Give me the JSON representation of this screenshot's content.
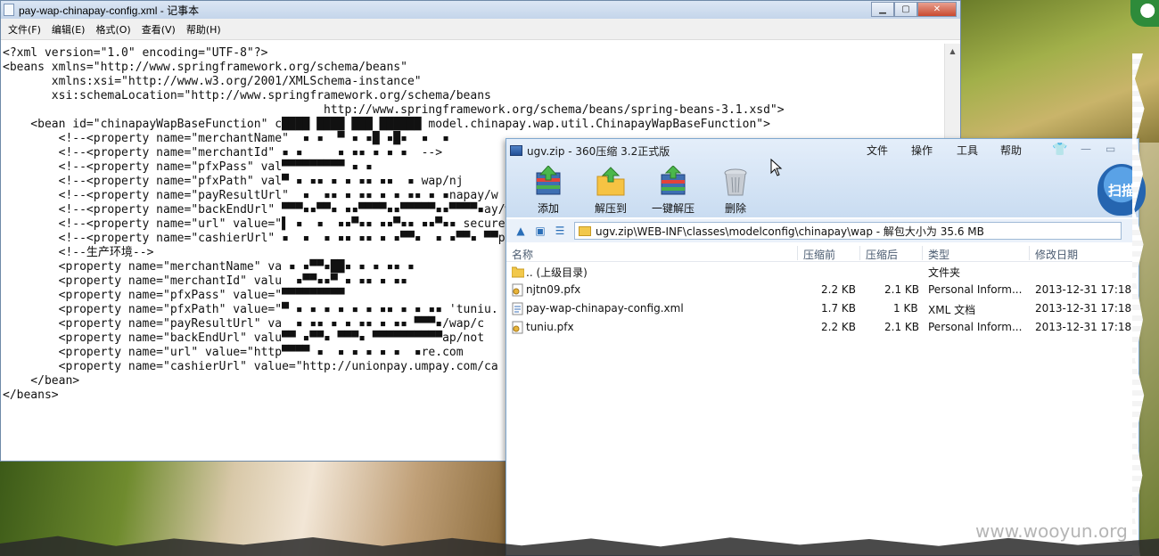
{
  "notepad": {
    "title": "pay-wap-chinapay-config.xml - 记事本",
    "menu": [
      "文件(F)",
      "编辑(E)",
      "格式(O)",
      "查看(V)",
      "帮助(H)"
    ],
    "lines": [
      "<?xml version=\"1.0\" encoding=\"UTF-8\"?>",
      "<beans xmlns=\"http://www.springframework.org/schema/beans\"",
      "       xmlns:xsi=\"http://www.w3.org/2001/XMLSchema-instance\"",
      "       xsi:schemaLocation=\"http://www.springframework.org/schema/beans",
      "                                              http://www.springframework.org/schema/beans/spring-beans-3.1.xsd\">",
      "    <bean id=\"chinapayWapBaseFunction\" c████ ████ ███ ██████ model.chinapay.wap.util.ChinapayWapBaseFunction\">",
      "        <!--<property name=\"merchantName\"  ▪ ▪  ▀ ▪ ▪█ ▪█▪  ▪  ▪",
      "        <!--<property name=\"merchantId\" ▪ ▪     ▪ ▪▪ ▪ ▪ ▪  -->",
      "        <!--<property name=\"pfxPass\" val▀▀▀▀▀▀▀▀▀ ▪ ▪",
      "        <!--<property name=\"pfxPath\" val▀ ▪ ▪▪ ▪ ▪ ▪▪ ▪▪  ▪ wap/nj",
      "        <!--<property name=\"payResultUrl\"  ▪  ▪▪ ▪ ▪▪ ▪ ▪ ▪▪ ▪ ▪napay/w",
      "        <!--<property name=\"backEndUrl\" ▀▀▀▪▪▀▀▪ ▪▪▀▀▀▀▪▪▀▀▀▀▀▪▪▀▀▀▀▪ay/wap",
      "        <!--<property name=\"url\" value=\"▌ ▪  ▪  ▪▪▀▪▪ ▪▪▀▪▪ ▪▪▀▪▪ secure",
      "        <!--<property name=\"cashierUrl\" ▪  ▪  ▪ ▪▪ ▪▪ ▪ ▪▀▀▪  ▪ ▪▀▀▪ ▀▀pay.co",
      "        <!--生产环境-->",
      "        <property name=\"merchantName\" va ▪ ▪▀▀▪██▪ ▪ ▪ ▪▪ ▪",
      "        <property name=\"merchantId\" valu  ▪▀▀▪▪▀ ▪ ▪▪ ▪ ▪▪",
      "        <property name=\"pfxPass\" value=\"▀▀▀▀▀▀▀▀▀",
      "        <property name=\"pfxPath\" value=\"▀ ▪ ▪ ▪ ▪ ▪ ▪ ▪▪ ▪ ▪ ▪▪ 'tuniu.",
      "        <property name=\"payResultUrl\" va  ▪ ▪▪ ▪ ▪ ▪▪ ▪ ▪▪ ▀▀▀▪/wap/c",
      "        <property name=\"backEndUrl\" valu▀▀ ▪▀▀▪ ▀▀▀▪ ▀▀▀▀▀▀▀▀▀▀ap/not",
      "        <property name=\"url\" value=\"http▀▀▀▀ ▪  ▪ ▪ ▪ ▪ ▪  ▪re.com",
      "        <property name=\"cashierUrl\" value=\"http://unionpay.umpay.com/ca",
      "    </bean>",
      "</beans>"
    ]
  },
  "zip": {
    "title": "ugv.zip - 360压缩 3.2正式版",
    "menu": [
      "文件",
      "操作",
      "工具",
      "帮助"
    ],
    "toolbar": [
      "添加",
      "解压到",
      "一键解压",
      "删除"
    ],
    "scan_label": "扫描",
    "address": "ugv.zip\\WEB-INF\\classes\\modelconfig\\chinapay\\wap - 解包大小为 35.6 MB",
    "columns": [
      "名称",
      "压缩前",
      "压缩后",
      "类型",
      "修改日期"
    ],
    "rows": [
      {
        "name": ".. (上级目录)",
        "before": "",
        "after": "",
        "type": "文件夹",
        "date": ""
      },
      {
        "name": "njtn09.pfx",
        "before": "2.2 KB",
        "after": "2.1 KB",
        "type": "Personal Inform...",
        "date": "2013-12-31 17:18"
      },
      {
        "name": "pay-wap-chinapay-config.xml",
        "before": "1.7 KB",
        "after": "1 KB",
        "type": "XML 文档",
        "date": "2013-12-31 17:18"
      },
      {
        "name": "tuniu.pfx",
        "before": "2.2 KB",
        "after": "2.1 KB",
        "type": "Personal Inform...",
        "date": "2013-12-31 17:18"
      }
    ]
  },
  "watermark": "www.wooyun.org"
}
